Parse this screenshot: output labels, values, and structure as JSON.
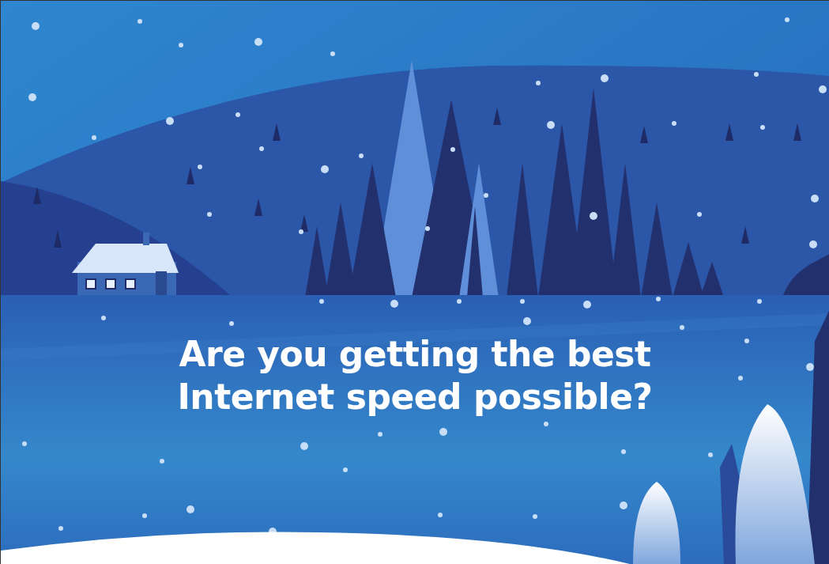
{
  "hero": {
    "headline": "Are you getting the best Internet speed possible?"
  }
}
